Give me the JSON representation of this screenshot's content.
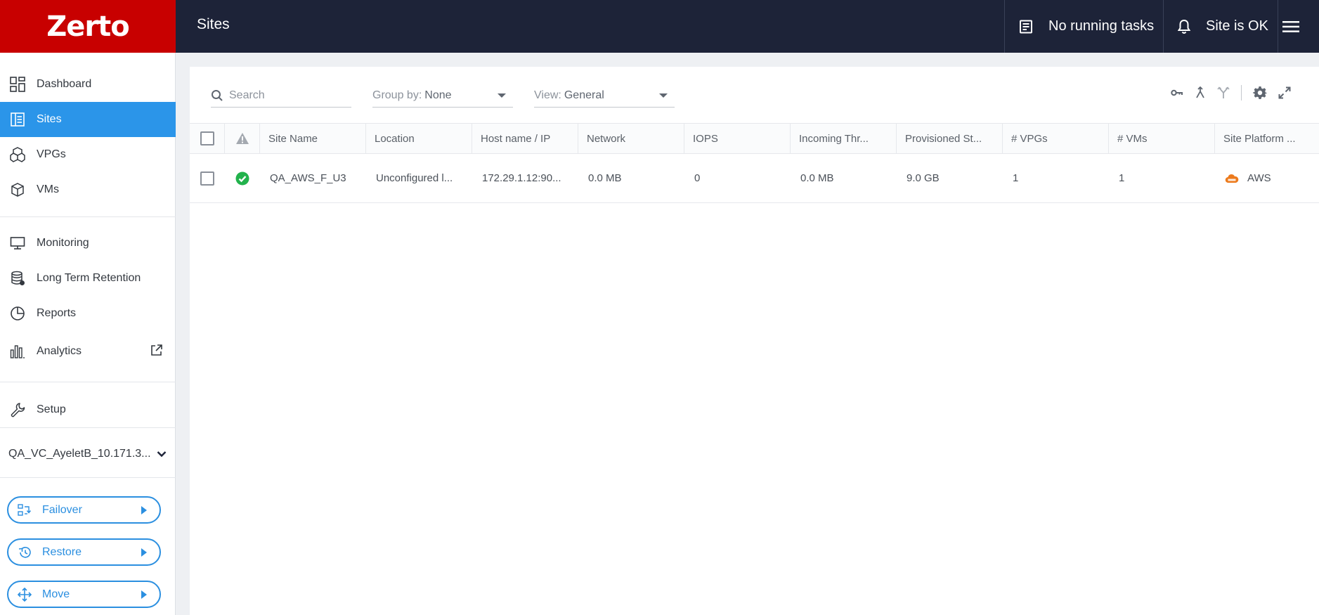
{
  "header": {
    "brand": "Zerto",
    "page_title": "Sites",
    "tasks_label": "No running tasks",
    "site_status": "Site is OK"
  },
  "sidebar": {
    "items": [
      {
        "label": "Dashboard",
        "icon": "dashboard-icon"
      },
      {
        "label": "Sites",
        "icon": "sites-icon",
        "active": true
      },
      {
        "label": "VPGs",
        "icon": "vpgs-icon"
      },
      {
        "label": "VMs",
        "icon": "vms-icon"
      },
      {
        "label": "Monitoring",
        "icon": "monitor-icon"
      },
      {
        "label": "Long Term Retention",
        "icon": "database-icon"
      },
      {
        "label": "Reports",
        "icon": "pie-chart-icon"
      },
      {
        "label": "Analytics",
        "icon": "bar-chart-icon"
      },
      {
        "label": "Setup",
        "icon": "wrench-icon"
      }
    ],
    "site_selector": "QA_VC_AyeletB_10.171.3...",
    "actions": [
      {
        "label": "Failover",
        "icon": "failover-icon"
      },
      {
        "label": "Restore",
        "icon": "restore-icon"
      },
      {
        "label": "Move",
        "icon": "move-icon"
      }
    ]
  },
  "toolbar": {
    "search_placeholder": "Search",
    "group_by_label": "Group by:",
    "group_by_value": "None",
    "view_label": "View:",
    "view_value": "General"
  },
  "table": {
    "columns": [
      "Site Name",
      "Location",
      "Host name / IP",
      "Network",
      "IOPS",
      "Incoming Thr...",
      "Provisioned St...",
      "# VPGs",
      "# VMs",
      "Site Platform ..."
    ],
    "rows": [
      {
        "status": "ok",
        "site_name": "QA_AWS_F_U3",
        "location": "Unconfigured l...",
        "host": "172.29.1.12:90...",
        "network": "0.0 MB",
        "iops": "0",
        "incoming": "0.0 MB",
        "provisioned": "9.0 GB",
        "vpgs": "1",
        "vms": "1",
        "platform": "AWS"
      }
    ]
  },
  "colors": {
    "brand_red": "#c80000",
    "topbar": "#1d2338",
    "accent_blue": "#2b95e9",
    "status_green": "#22b24c",
    "aws_orange": "#ec7a1c"
  }
}
